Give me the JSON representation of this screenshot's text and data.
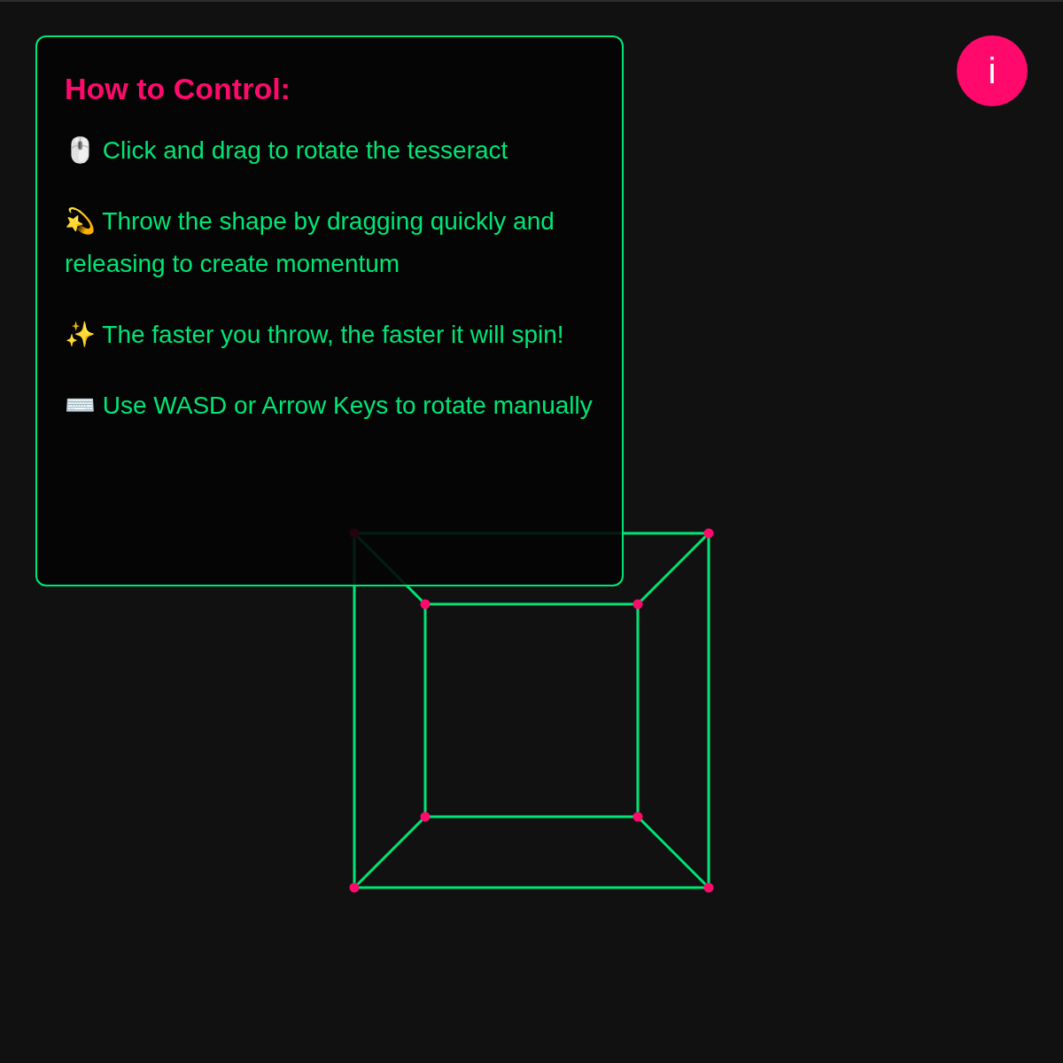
{
  "panel": {
    "title": "How to Control:",
    "items": [
      "🖱️ Click and drag to rotate the tesseract",
      "💫 Throw the shape by dragging quickly and releasing to create momentum",
      "✨ The faster you throw, the faster it will spin!",
      "⌨️ Use WASD or Arrow Keys to rotate manually"
    ]
  },
  "info_button": {
    "label": "i"
  }
}
